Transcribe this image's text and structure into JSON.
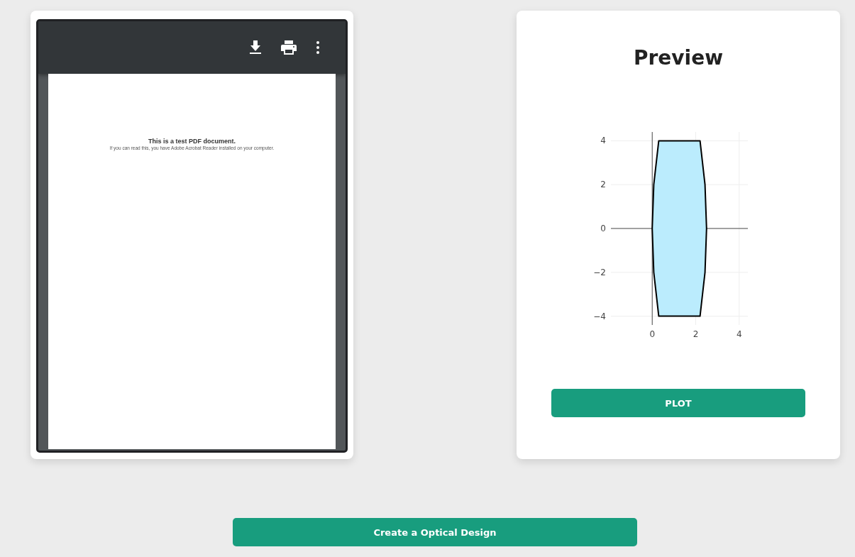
{
  "pdf_viewer": {
    "page": {
      "heading": "This is a test PDF document.",
      "body": "If you can read this, you have Adobe Acrobat Reader installed on your computer."
    }
  },
  "preview": {
    "title": "Preview",
    "chart_data": {
      "type": "area",
      "x": [
        0.3,
        2.2,
        2.43,
        2.5,
        2.43,
        2.2,
        0.3,
        0.07,
        0,
        0.07,
        0.3
      ],
      "series": [
        {
          "color": "#000000",
          "values": [
            4,
            4,
            2,
            0,
            -2,
            -4,
            -4,
            -2,
            0,
            2,
            4
          ]
        }
      ],
      "xticks": [
        0,
        2,
        4
      ],
      "yticks": [
        -4,
        -2,
        0,
        2,
        4
      ],
      "grid": true,
      "xlim": [
        -1.9,
        4.4
      ],
      "ylim": [
        -4.4,
        4.4
      ]
    },
    "button": "PLOT"
  },
  "footer_button": "Create a Optical Design"
}
